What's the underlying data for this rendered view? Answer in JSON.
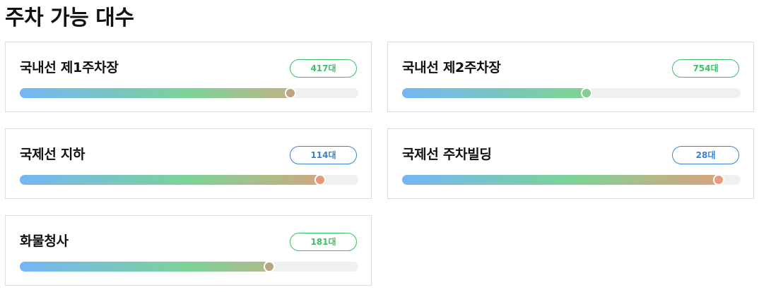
{
  "page": {
    "title": "주차 가능 대수"
  },
  "gradient_colors": [
    "#74b6f6",
    "#7bd396",
    "#e99c7c"
  ],
  "lots": [
    {
      "name": "국내선 제1주차장",
      "count": "417대",
      "fill": 0.8,
      "badge_color": "#3fbf6a",
      "knob_color": "#c1a383"
    },
    {
      "name": "국내선 제2주차장",
      "count": "754대",
      "fill": 0.545,
      "badge_color": "#3fbf6a",
      "knob_color": "#85cd90"
    },
    {
      "name": "국제선 지하",
      "count": "114대",
      "fill": 0.887,
      "badge_color": "#3b7fd4",
      "knob_color": "#e19a7b"
    },
    {
      "name": "국제선 주차빌딩",
      "count": "28대",
      "fill": 0.935,
      "badge_color": "#3b7fd4",
      "knob_color": "#e99c7c"
    },
    {
      "name": "화물청사",
      "count": "181대",
      "fill": 0.736,
      "badge_color": "#3fbf6a",
      "knob_color": "#b5a67f"
    }
  ]
}
